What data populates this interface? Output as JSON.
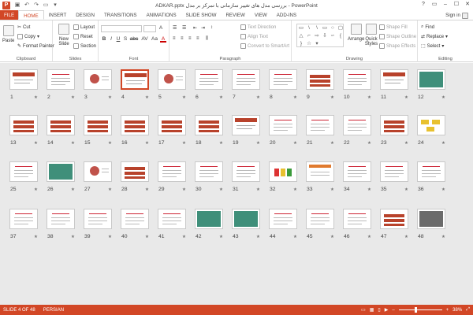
{
  "titlebar": {
    "app_icon": "powerpoint-icon",
    "title": "ADKAR.pptx بررسی مدل های تغییر سازمانی با تمرکز بر مدل - PowerPoint",
    "qat": [
      "save-icon",
      "undo-icon",
      "redo-icon",
      "start-icon",
      "customize-icon"
    ],
    "controls": [
      "?",
      "▭",
      "–",
      "☐",
      "✕"
    ]
  },
  "tabs": [
    "FILE",
    "HOME",
    "INSERT",
    "DESIGN",
    "TRANSITIONS",
    "ANIMATIONS",
    "SLIDE SHOW",
    "REVIEW",
    "VIEW",
    "ADD-INS"
  ],
  "active_tab": "HOME",
  "signin": "Sign in",
  "ribbon": {
    "clipboard": {
      "label": "Clipboard",
      "paste": "Paste",
      "cut": "Cut",
      "copy": "Copy",
      "format_painter": "Format Painter"
    },
    "slides": {
      "label": "Slides",
      "new_slide": "New Slide",
      "layout": "Layout",
      "reset": "Reset",
      "section": "Section"
    },
    "font": {
      "label": "Font",
      "bold": "B",
      "italic": "I",
      "underline": "U",
      "strike": "S",
      "abc": "abc",
      "av": "AV",
      "aa": "Aa",
      "font_color": "A"
    },
    "paragraph": {
      "label": "Paragraph",
      "text_direction": "Text Direction",
      "align_text": "Align Text",
      "convert_smartart": "Convert to SmartArt"
    },
    "drawing": {
      "label": "Drawing",
      "arrange": "Arrange",
      "quick_styles": "Quick Styles",
      "shape_fill": "Shape Fill",
      "shape_outline": "Shape Outline",
      "shape_effects": "Shape Effects"
    },
    "editing": {
      "label": "Editing",
      "find": "Find",
      "replace": "Replace",
      "select": "Select"
    }
  },
  "slides": {
    "total": 48,
    "selected": 4,
    "numbers": [
      "1",
      "2",
      "3",
      "4",
      "5",
      "6",
      "7",
      "8",
      "9",
      "10",
      "11",
      "12",
      "13",
      "14",
      "15",
      "16",
      "17",
      "18",
      "19",
      "20",
      "21",
      "22",
      "23",
      "24",
      "25",
      "26",
      "27",
      "28",
      "29",
      "30",
      "31",
      "32",
      "33",
      "34",
      "35",
      "36",
      "37",
      "38",
      "39",
      "40",
      "41",
      "42",
      "43",
      "44",
      "45",
      "46",
      "47",
      "48"
    ],
    "star": "★"
  },
  "status": {
    "slide_info": "SLIDE 4 OF 48",
    "language": "PERSIAN",
    "zoom": "38%"
  },
  "colors": {
    "accent": "#d24726",
    "sorter_bg": "#e9e9e9",
    "thumb_red": "#b8422b"
  }
}
